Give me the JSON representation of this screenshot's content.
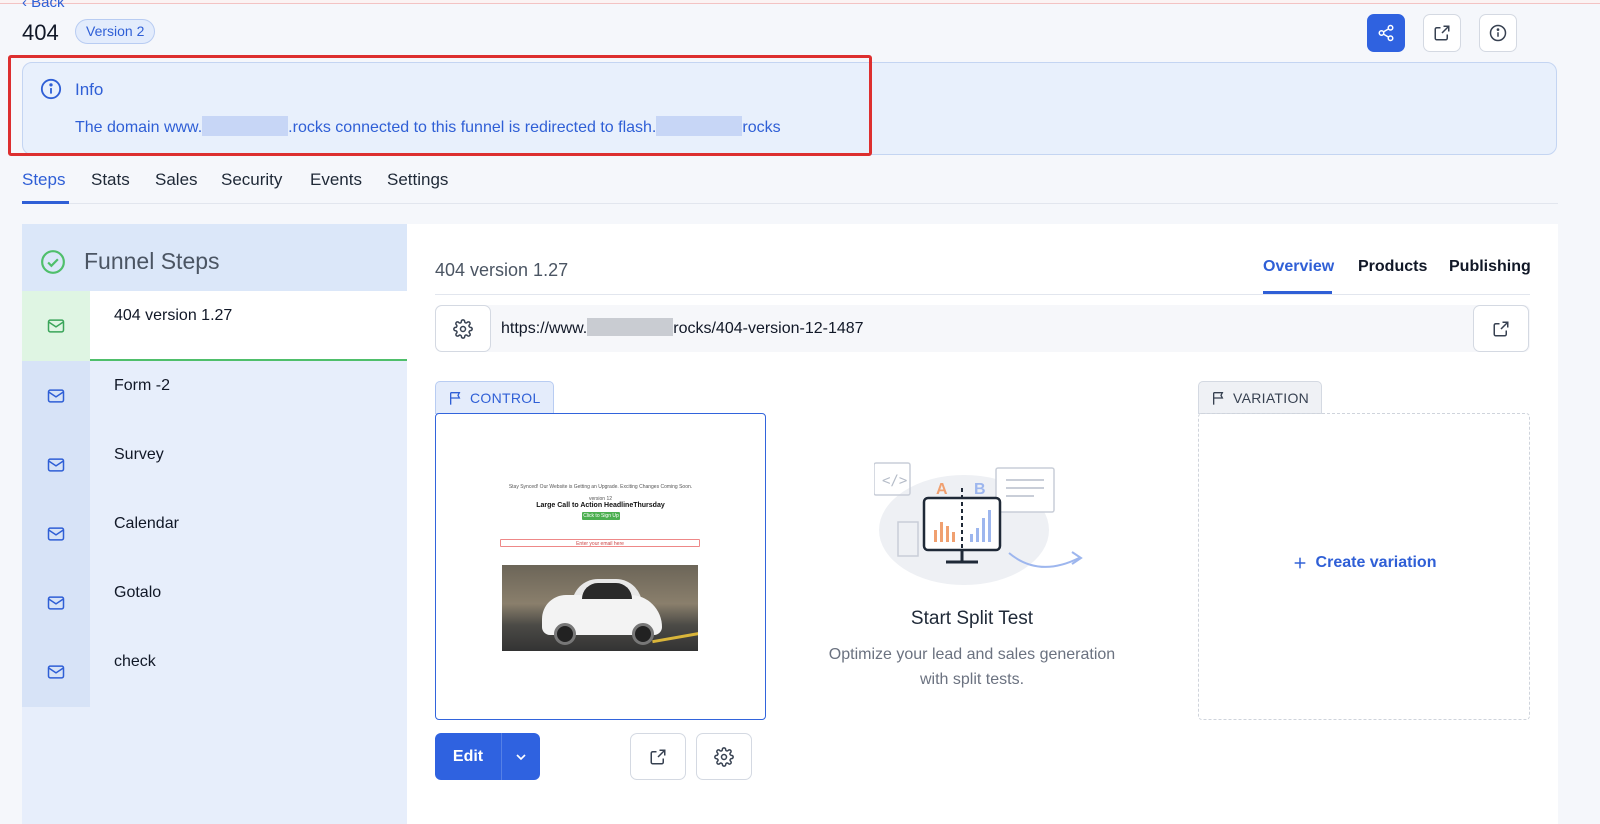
{
  "header": {
    "back_label": "‹ Back",
    "title": "404",
    "version_badge": "Version 2",
    "actions": [
      {
        "name": "share",
        "icon": "share-icon"
      },
      {
        "name": "open-external",
        "icon": "external-link-icon"
      },
      {
        "name": "info",
        "icon": "info-icon"
      }
    ]
  },
  "info_banner": {
    "title": "Info",
    "text_prefix": "The domain www.",
    "text_middle": ".rocks connected to this funnel is redirected to flash.",
    "text_suffix": "rocks"
  },
  "tabs": [
    "Steps",
    "Stats",
    "Sales",
    "Security",
    "Events",
    "Settings"
  ],
  "active_tab": "Steps",
  "sidebar": {
    "title": "Funnel Steps",
    "steps": [
      {
        "label": "404 version 1.27",
        "icon": "mail-icon",
        "active": true
      },
      {
        "label": "Form -2",
        "icon": "mail-icon"
      },
      {
        "label": "Survey",
        "icon": "mail-icon"
      },
      {
        "label": "Calendar",
        "icon": "mail-icon"
      },
      {
        "label": "Gotalo",
        "icon": "mail-icon"
      },
      {
        "label": "check",
        "icon": "mail-icon"
      }
    ]
  },
  "main": {
    "title": "404 version 1.27",
    "tabs": [
      "Overview",
      "Products",
      "Publishing"
    ],
    "active_tab": "Overview",
    "url_prefix": "https://www.",
    "url_suffix": "rocks/404-version-12-1487",
    "control_label": "CONTROL",
    "variation_label": "VARIATION",
    "preview": {
      "small_line": "Stay Synced! Our Website is Getting an Upgrade. Exciting Changes Coming Soon.",
      "version_line": "version 12",
      "headline": "Large Call to Action HeadlineThursday",
      "button_text": "Click to Sign Up",
      "input_text": "Enter your email here"
    },
    "split_test": {
      "title": "Start Split Test",
      "description": "Optimize your lead and sales generation with split tests."
    },
    "create_variation": "Create variation",
    "edit_label": "Edit"
  },
  "colors": {
    "accent": "#2f62e0",
    "success": "#4fbf6b",
    "highlight": "#dd2f2f"
  }
}
